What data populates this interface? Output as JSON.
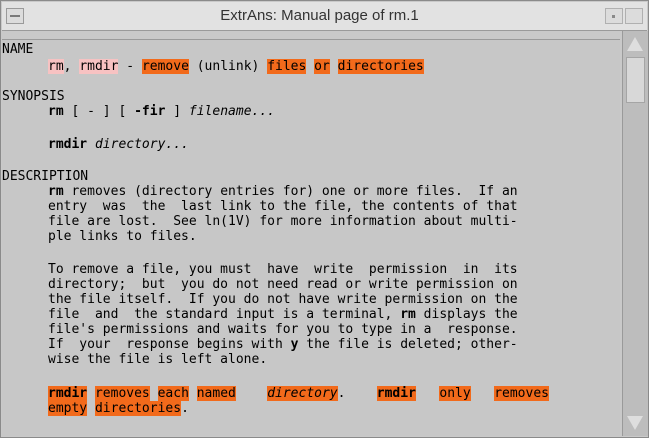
{
  "window": {
    "title": "ExtrAns: Manual page of rm.1"
  },
  "name": {
    "heading": "NAME",
    "cmd1": "rm",
    "sep": ", ",
    "cmd2": "rmdir",
    "dash": " - ",
    "w_remove": "remove",
    "w_unlink": " (unlink) ",
    "w_files": "files",
    "sp1": " ",
    "w_or": "or",
    "sp2": " ",
    "w_directories": "directories"
  },
  "synopsis": {
    "heading": "SYNOPSIS",
    "rm_cmd": "rm",
    "rm_opts1": " [ - ] [ ",
    "rm_flags": "-fir",
    "rm_opts2": " ] ",
    "rm_arg": "filename...",
    "rmdir_cmd": "rmdir",
    "rmdir_sp": " ",
    "rmdir_arg": "directory..."
  },
  "description": {
    "heading": "DESCRIPTION",
    "p1": {
      "l1_cmd": "rm",
      "l1": " removes (directory entries for) one or more files.  If an",
      "l2": "entry  was  the  last link to the file, the contents of that",
      "l3": "file are lost.  See ln(1V) for more information about multi-",
      "l4": "ple links to files."
    },
    "p2": {
      "l1": "To remove a file, you must  have  write  permission  in  its",
      "l2": "directory;  but  you do not need read or write permission on",
      "l3": "the file itself.  If you do not have write permission on the",
      "l4a": "file  and  the standard input is a terminal, ",
      "l4_cmd": "rm",
      "l4b": " displays the",
      "l5": "file's permissions and waits for you to type in a  response.",
      "l6a": "If  your  response begins with ",
      "l6_y": "y",
      "l6b": " the file is deleted; other-",
      "l7": "wise the file is left alone."
    },
    "p3": {
      "w_rmdir": "rmdir",
      "s1": " ",
      "w_removes": "removes",
      "s2": " ",
      "w_each": "each",
      "s3": " ",
      "w_named": "named",
      "s4": "    ",
      "w_directory": "directory",
      "s5": ".    ",
      "w_rmdir2": "rmdir",
      "s6": "   ",
      "w_only": "only",
      "s7": "   ",
      "w_removes2": "removes",
      "w_empty": "empty",
      "s8": " ",
      "w_directories": "directories",
      "end": "."
    }
  }
}
